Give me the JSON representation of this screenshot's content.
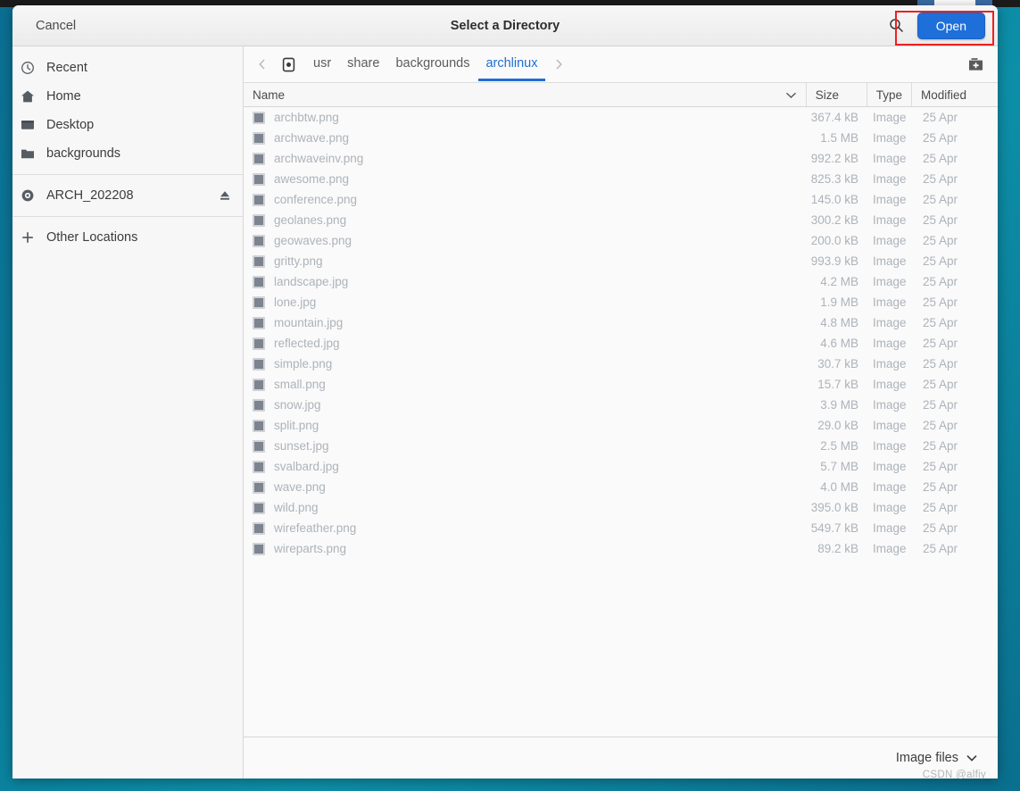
{
  "window": {
    "title": "Select a Directory",
    "cancel_label": "Cancel",
    "open_label": "Open",
    "search_icon": "search-icon",
    "accent_color": "#1e6fd9",
    "highlight_color": "#ef1f1f",
    "desktop_background": "#0a7d9b"
  },
  "sidebar": {
    "items": [
      {
        "label": "Recent",
        "icon": "clock-icon",
        "eject": false
      },
      {
        "label": "Home",
        "icon": "home-icon",
        "eject": false
      },
      {
        "label": "Desktop",
        "icon": "desktop-icon",
        "eject": false
      },
      {
        "label": "backgrounds",
        "icon": "folder-icon",
        "eject": false
      },
      {
        "label": "ARCH_202208",
        "icon": "disc-icon",
        "eject": true
      },
      {
        "label": "Other Locations",
        "icon": "plus-icon",
        "eject": false
      }
    ]
  },
  "pathbar": {
    "back_icon": "chevron-left-icon",
    "forward_icon": "chevron-right-icon",
    "device_icon": "device-icon",
    "new_folder_icon": "new-folder-icon",
    "crumbs": [
      {
        "label": "usr",
        "active": false
      },
      {
        "label": "share",
        "active": false
      },
      {
        "label": "backgrounds",
        "active": false
      },
      {
        "label": "archlinux",
        "active": true
      }
    ]
  },
  "file_list": {
    "columns": {
      "name": "Name",
      "size": "Size",
      "type": "Type",
      "modified": "Modified"
    },
    "sort_icon": "chevron-down-icon",
    "rows": [
      {
        "name": "archbtw.png",
        "size": "367.4 kB",
        "type": "Image",
        "modified": "25 Apr"
      },
      {
        "name": "archwave.png",
        "size": "1.5 MB",
        "type": "Image",
        "modified": "25 Apr"
      },
      {
        "name": "archwaveinv.png",
        "size": "992.2 kB",
        "type": "Image",
        "modified": "25 Apr"
      },
      {
        "name": "awesome.png",
        "size": "825.3 kB",
        "type": "Image",
        "modified": "25 Apr"
      },
      {
        "name": "conference.png",
        "size": "145.0 kB",
        "type": "Image",
        "modified": "25 Apr"
      },
      {
        "name": "geolanes.png",
        "size": "300.2 kB",
        "type": "Image",
        "modified": "25 Apr"
      },
      {
        "name": "geowaves.png",
        "size": "200.0 kB",
        "type": "Image",
        "modified": "25 Apr"
      },
      {
        "name": "gritty.png",
        "size": "993.9 kB",
        "type": "Image",
        "modified": "25 Apr"
      },
      {
        "name": "landscape.jpg",
        "size": "4.2 MB",
        "type": "Image",
        "modified": "25 Apr"
      },
      {
        "name": "lone.jpg",
        "size": "1.9 MB",
        "type": "Image",
        "modified": "25 Apr"
      },
      {
        "name": "mountain.jpg",
        "size": "4.8 MB",
        "type": "Image",
        "modified": "25 Apr"
      },
      {
        "name": "reflected.jpg",
        "size": "4.6 MB",
        "type": "Image",
        "modified": "25 Apr"
      },
      {
        "name": "simple.png",
        "size": "30.7 kB",
        "type": "Image",
        "modified": "25 Apr"
      },
      {
        "name": "small.png",
        "size": "15.7 kB",
        "type": "Image",
        "modified": "25 Apr"
      },
      {
        "name": "snow.jpg",
        "size": "3.9 MB",
        "type": "Image",
        "modified": "25 Apr"
      },
      {
        "name": "split.png",
        "size": "29.0 kB",
        "type": "Image",
        "modified": "25 Apr"
      },
      {
        "name": "sunset.jpg",
        "size": "2.5 MB",
        "type": "Image",
        "modified": "25 Apr"
      },
      {
        "name": "svalbard.jpg",
        "size": "5.7 MB",
        "type": "Image",
        "modified": "25 Apr"
      },
      {
        "name": "wave.png",
        "size": "4.0 MB",
        "type": "Image",
        "modified": "25 Apr"
      },
      {
        "name": "wild.png",
        "size": "395.0 kB",
        "type": "Image",
        "modified": "25 Apr"
      },
      {
        "name": "wirefeather.png",
        "size": "549.7 kB",
        "type": "Image",
        "modified": "25 Apr"
      },
      {
        "name": "wireparts.png",
        "size": "89.2 kB",
        "type": "Image",
        "modified": "25 Apr"
      }
    ]
  },
  "footer": {
    "filter_label": "Image files",
    "filter_icon": "chevron-down-icon"
  },
  "watermark": "CSDN @alfiy"
}
